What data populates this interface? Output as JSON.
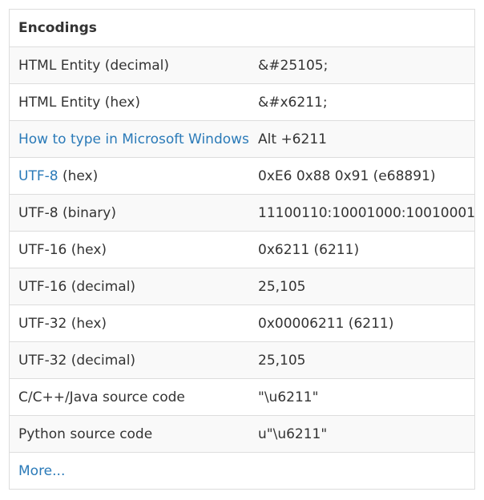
{
  "encodings": {
    "title": "Encodings",
    "rows": [
      {
        "label": "HTML Entity (decimal)",
        "value": "&#25105;"
      },
      {
        "label": "HTML Entity (hex)",
        "value": "&#x6211;"
      },
      {
        "label_link": "How to type in Microsoft Windows",
        "value_prefix": "Alt",
        "value_key": "+6211"
      },
      {
        "label_link": "UTF-8",
        "label_suffix": " (hex)",
        "value": "0xE6 0x88 0x91 (e68891)"
      },
      {
        "label": "UTF-8 (binary)",
        "value": "11100110:10001000:10010001"
      },
      {
        "label": "UTF-16 (hex)",
        "value": "0x6211 (6211)"
      },
      {
        "label": "UTF-16 (decimal)",
        "value": "25,105"
      },
      {
        "label": "UTF-32 (hex)",
        "value": "0x00006211 (6211)"
      },
      {
        "label": "UTF-32 (decimal)",
        "value": "25,105"
      },
      {
        "label": "C/C++/Java source code",
        "value": "\"\\u6211\""
      },
      {
        "label": "Python source code",
        "value": "u\"\\u6211\""
      }
    ],
    "more_link": "More..."
  },
  "colors": {
    "link": "#2a7ab8",
    "text": "#333333",
    "border": "#dddddd",
    "row_alt_bg": "#f9f9f9"
  }
}
